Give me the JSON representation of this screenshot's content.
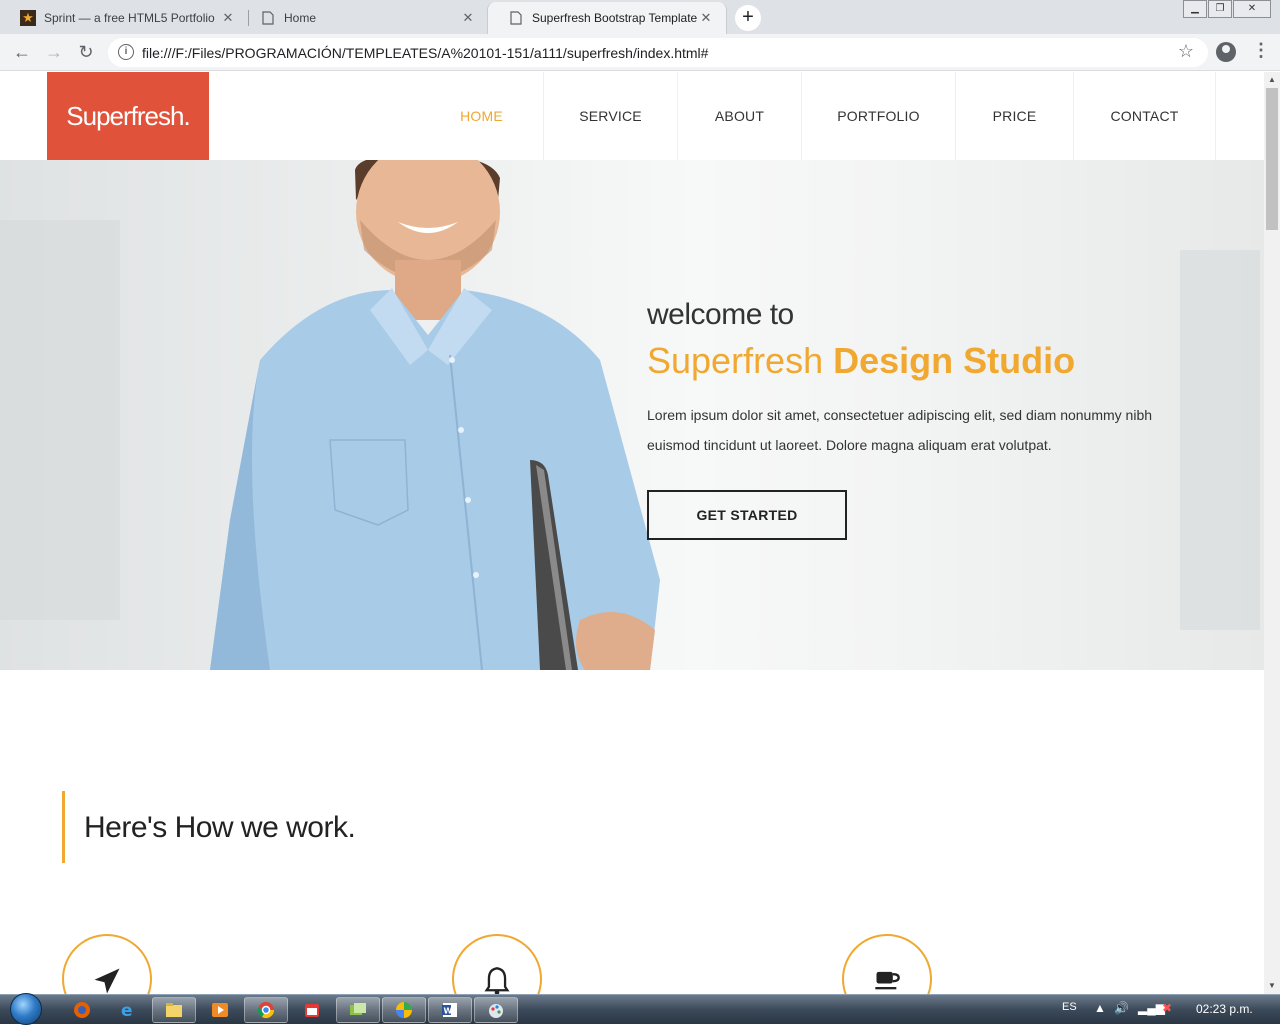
{
  "browser": {
    "tabs": [
      {
        "title": "Sprint — a free HTML5 Portfolio",
        "icon": "star-favicon",
        "active": false
      },
      {
        "title": "Home",
        "icon": "page-icon",
        "active": false
      },
      {
        "title": "Superfresh Bootstrap Template",
        "icon": "page-icon",
        "active": true
      }
    ],
    "new_tab": "+",
    "url": "file:///F:/Files/PROGRAMACIÓN/TEMPLEATES/A%20101-151/a111/superfresh/index.html#"
  },
  "site": {
    "logo": "Superfresh.",
    "menu": [
      "HOME",
      "SERVICE",
      "ABOUT",
      "PORTFOLIO",
      "PRICE",
      "CONTACT"
    ],
    "active_menu": "HOME",
    "hero": {
      "welcome": "welcome to",
      "title_normal": "Superfresh ",
      "title_bold": "Design Studio",
      "text": "Lorem ipsum dolor sit amet, consectetuer adipiscing elit, sed diam nonummy nibh euismod tincidunt ut laoreet. Dolore magna aliquam erat volutpat.",
      "cta": "GET STARTED"
    },
    "work_heading": "Here's How we work.",
    "feature_icons": [
      "paper-plane-icon",
      "bell-icon",
      "coffee-cup-icon"
    ]
  },
  "taskbar": {
    "language": "ES",
    "time": "02:23 p.m."
  },
  "colors": {
    "brand": "#e0533a",
    "accent": "#f0a830"
  }
}
